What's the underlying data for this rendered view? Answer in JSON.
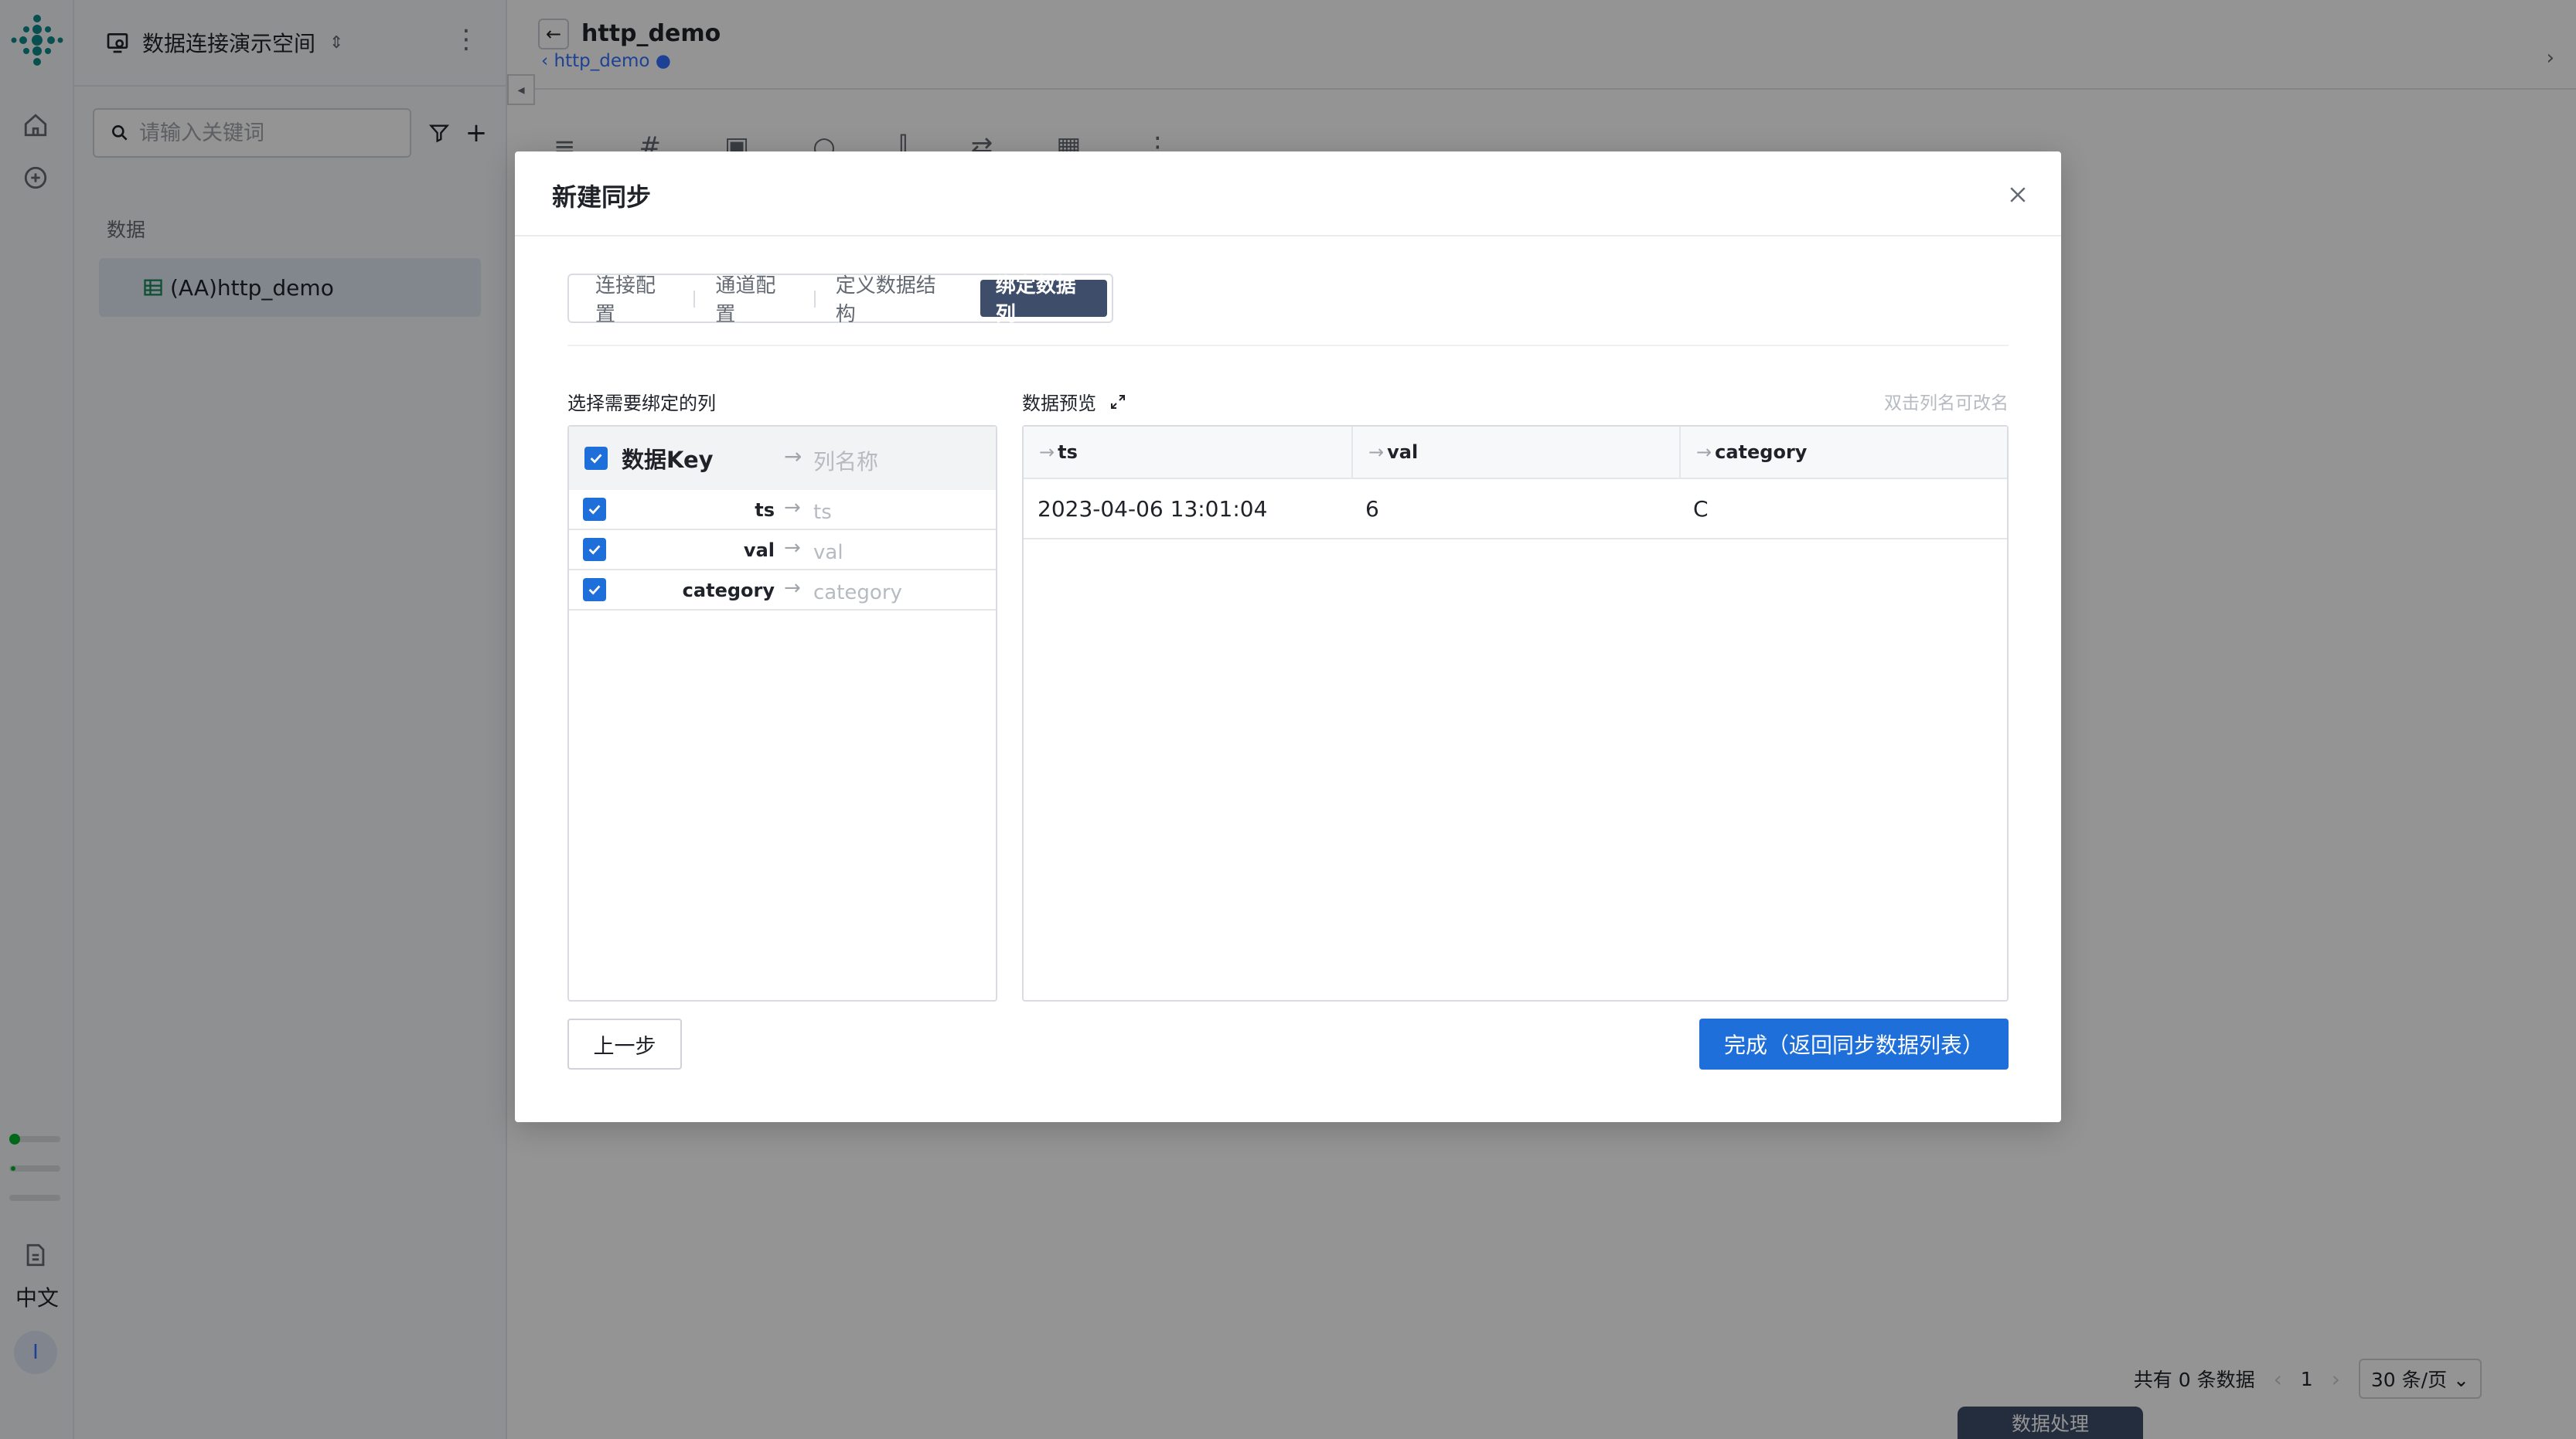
{
  "rail": {
    "lang": "中文",
    "avatar": "I"
  },
  "sidebar": {
    "space_title": "数据连接演示空间",
    "search_placeholder": "请输入关键词",
    "section_label": "数据",
    "items": [
      {
        "label": "(AA)http_demo"
      }
    ]
  },
  "main": {
    "title": "http_demo",
    "breadcrumb": "http_demo",
    "pager": {
      "total": "共有 0 条数据",
      "page": "1",
      "size": "30 条/页"
    },
    "bottom_tab": "数据处理"
  },
  "modal": {
    "title": "新建同步",
    "steps": [
      {
        "label": "连接配置",
        "active": false
      },
      {
        "label": "通道配置",
        "active": false
      },
      {
        "label": "定义数据结构",
        "active": false
      },
      {
        "label": "绑定数据列",
        "active": true
      }
    ],
    "left_label": "选择需要绑定的列",
    "bind_header": {
      "key": "数据Key",
      "colname": "列名称"
    },
    "bind_rows": [
      {
        "key": "ts",
        "placeholder": "ts",
        "checked": true
      },
      {
        "key": "val",
        "placeholder": "val",
        "checked": true
      },
      {
        "key": "category",
        "placeholder": "category",
        "checked": true
      }
    ],
    "preview_label": "数据预览",
    "preview_hint": "双击列名可改名",
    "preview_columns": [
      "ts",
      "val",
      "category"
    ],
    "preview_rows": [
      [
        "2023-04-06 13:01:04",
        "6",
        "C"
      ]
    ],
    "prev_button": "上一步",
    "done_button": "完成（返回同步数据列表）"
  },
  "colors": {
    "accent": "#1e6fd9",
    "active_step": "#3e4e6a",
    "logo": "#0f8a8a"
  }
}
